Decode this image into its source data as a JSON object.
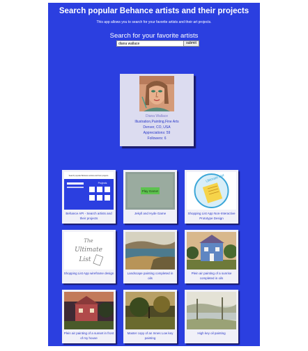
{
  "header": {
    "title": "Search popular Behance artists and their projects",
    "subtitle": "This app allows you to search for your favorite artists and their art projects."
  },
  "search": {
    "heading": "Search for your favorite artists",
    "value": "diana wallace",
    "submit_label": "submit"
  },
  "profile": {
    "name": "Diana Wallace",
    "fields": "Illustration,Painting,Fine Arts",
    "location": "Denver, CO, USA",
    "appreciations": "Appreciations: 59",
    "followers": "Followers: 6"
  },
  "thumbs": {
    "behance_header": "Search popular Behance artists and their projects",
    "behance_projects": "Projects",
    "play_game": "Play Game!",
    "ultimate_list": "Ultimate List"
  },
  "projects": [
    {
      "title": "Behance API - Search artists and their projects"
    },
    {
      "title": "Jekyll and Hyde Game"
    },
    {
      "title": "Shopping List App Non-Interactive Prototype Design"
    },
    {
      "title": "Shopping List App wireframe design"
    },
    {
      "title": "Landscape painting completed in oils"
    },
    {
      "title": "Plein air painting of a sunrise completed in oils"
    },
    {
      "title": "Plein air painting of a sunset in front of my house"
    },
    {
      "title": "Master copy of an Innes Low key painting"
    },
    {
      "title": "High key oil painting"
    }
  ]
}
